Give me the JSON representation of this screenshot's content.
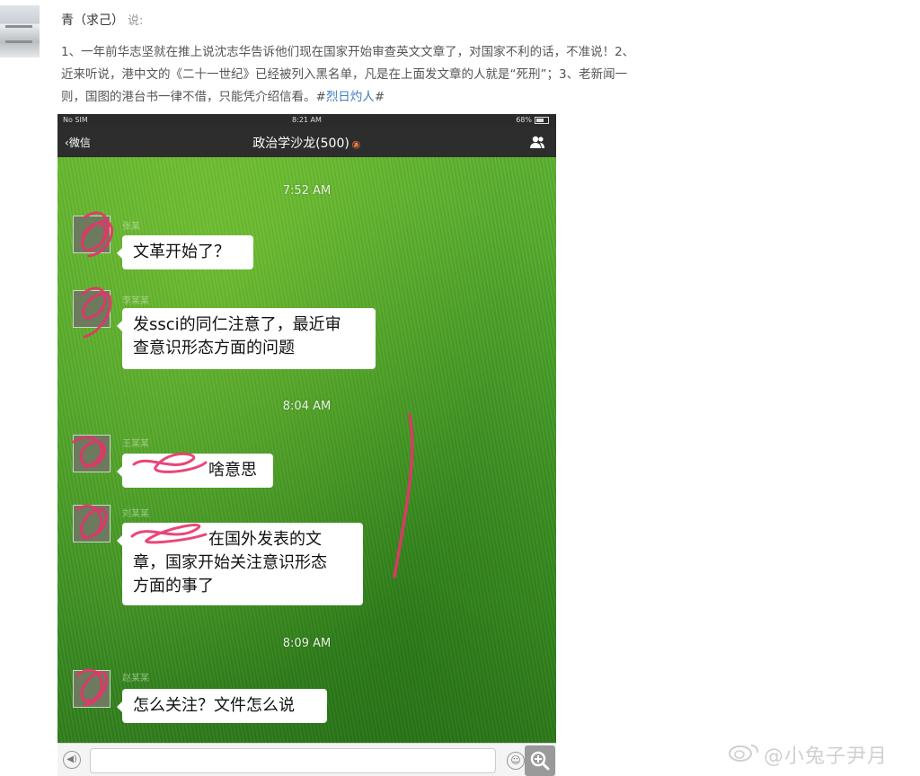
{
  "post": {
    "author": "青（求己）",
    "said": "说:",
    "text_before_tag": "1、一年前华志坚就在推上说沈志华告诉他们现在国家开始审查英文文章了，对国家不利的话，不准说！2、近来听说，港中文的《二十一世纪》已经被列入黑名单，凡是在上面发文章的人就是“死刑”；3、老新闻一则，国图的港台书一律不借，只能凭介绍信看。#",
    "hashtag": "烈日灼人",
    "text_after_tag": "#"
  },
  "phone": {
    "status": {
      "carrier": "No SIM",
      "time": "8:21 AM",
      "battery": "68%"
    },
    "nav": {
      "back": "微信",
      "title": "政治学沙龙(500)"
    },
    "chat": {
      "timestamps": [
        "7:52 AM",
        "8:04 AM",
        "8:09 AM"
      ],
      "messages": [
        {
          "sender": "张某",
          "text": "文革开始了？"
        },
        {
          "sender": "李某某",
          "line1": "发ssci的同仁注意了，最近审",
          "line2": "查意识形态方面的问题"
        },
        {
          "sender": "王某某",
          "text": "啥意思"
        },
        {
          "sender": "刘某某",
          "line1": "在国外发表的文",
          "line2": "章，国家开始关注意识形态",
          "line3": "方面的事了"
        },
        {
          "sender": "赵某某",
          "text": "怎么关注？文件怎么说"
        }
      ]
    }
  },
  "watermark": "@小兔子尹月",
  "colors": {
    "scribble": "#e8336a",
    "grass": "#4aa22a",
    "hashtag": "#3f7cbf"
  }
}
